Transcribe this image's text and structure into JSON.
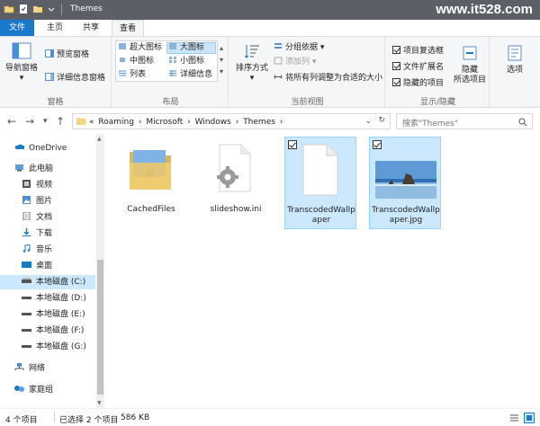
{
  "window": {
    "title": "Themes",
    "watermark": "www.it528.com"
  },
  "ribbon_tabs": [
    "文件",
    "主页",
    "共享",
    "查看"
  ],
  "ribbon": {
    "panes": {
      "nav_pane": "导航窗格",
      "preview_pane": "预览窗格",
      "details_pane": "详细信息窗格",
      "label": "窗格"
    },
    "layout": {
      "items": [
        "超大图标",
        "大图标",
        "中图标",
        "小图标",
        "列表",
        "详细信息"
      ],
      "label": "布局"
    },
    "current_view": {
      "sort_by": "排序方式",
      "group_by": "分组依据",
      "add_columns": "添加列",
      "size_all_columns": "将所有列调整为合适的大小",
      "label": "当前视图"
    },
    "show_hide": {
      "item_check_boxes": "项目复选框",
      "file_extensions": "文件扩展名",
      "hidden_items": "隐藏的项目",
      "hide_selected": "隐藏",
      "hide_selected_2": "所选项目",
      "options": "选项",
      "label": "显示/隐藏"
    }
  },
  "address": {
    "crumbs": [
      "«",
      "Roaming",
      "›",
      "Microsoft",
      "›",
      "Windows",
      "›",
      "Themes",
      "›"
    ],
    "search_placeholder": "搜索\"Themes\""
  },
  "nav_pane": {
    "items": [
      "OneDrive",
      "此电脑",
      "视频",
      "图片",
      "文档",
      "下载",
      "音乐",
      "桌面",
      "本地磁盘 (C:)",
      "本地磁盘 (D:)",
      "本地磁盘 (E:)",
      "本地磁盘 (F:)",
      "本地磁盘 (G:)",
      "网络",
      "家庭组"
    ]
  },
  "files": [
    {
      "name": "CachedFiles"
    },
    {
      "name": "slideshow.ini"
    },
    {
      "name": "TranscodedWallpaper"
    },
    {
      "name": "TranscodedWallpaper.jpg"
    }
  ],
  "status": {
    "count": "4 个项目",
    "selected": "已选择 2 个项目",
    "size": "586 KB"
  },
  "colors": {
    "accent": "#1979ca",
    "selection": "#cce8ff",
    "titlebar": "#5c5f66"
  }
}
